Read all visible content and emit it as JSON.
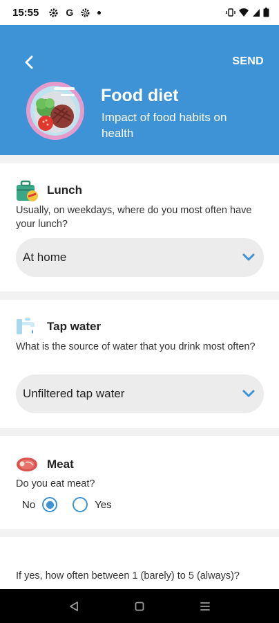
{
  "status_bar": {
    "time": "15:55",
    "google_letter": "G"
  },
  "header": {
    "send_label": "SEND",
    "title": "Food diet",
    "subtitle": "Impact of food habits on health"
  },
  "questions": [
    {
      "icon": "lunchbox-icon",
      "title": "Lunch",
      "description": "Usually, on weekdays, where do you most often have your lunch?",
      "selected": "At home"
    },
    {
      "icon": "tap-water-icon",
      "title": "Tap water",
      "description": "What is the source of water that you drink most often?",
      "selected": "Unfiltered tap water"
    },
    {
      "icon": "meat-icon",
      "title": "Meat",
      "description": "Do you eat meat?",
      "options": [
        {
          "label": "No",
          "selected": true
        },
        {
          "label": "Yes",
          "selected": false
        }
      ]
    },
    {
      "description": "If yes, how often between 1 (barely) to 5 (always)?"
    }
  ],
  "colors": {
    "primary": "#3d93d5",
    "background": "#f2f2f2",
    "card": "#ffffff",
    "select_bg": "#ececec"
  }
}
